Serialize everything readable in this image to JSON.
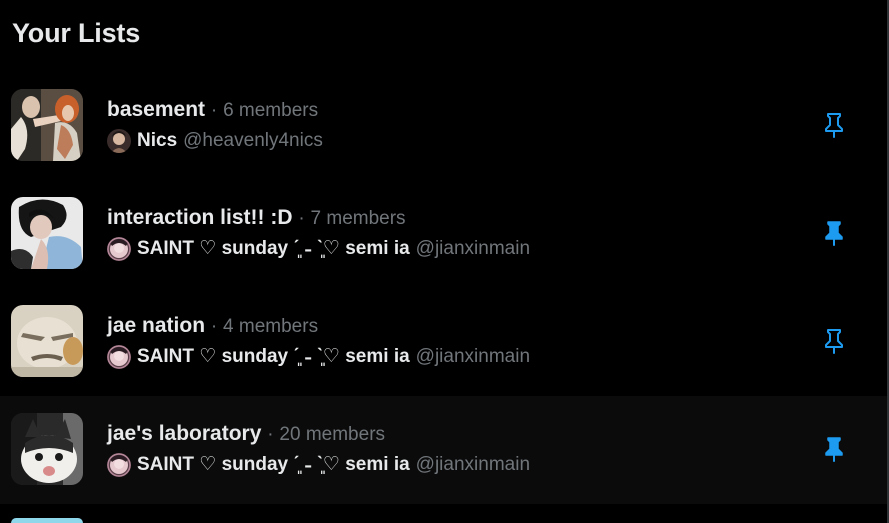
{
  "section": {
    "title": "Your Lists"
  },
  "sep": "·",
  "lists": [
    {
      "name": "basement",
      "members": "6 members",
      "owner_name": "Nics",
      "owner_handle": "@heavenly4nics",
      "pinned": false
    },
    {
      "name": "interaction list!! :D",
      "members": "7 members",
      "owner_name": "SAINT ♡ sunday ˊ͈ ˗ ˋ͈♡ semi ia",
      "owner_handle": "@jianxinmain",
      "pinned": true
    },
    {
      "name": "jae nation",
      "members": "4 members",
      "owner_name": "SAINT ♡ sunday ˊ͈ ˗ ˋ͈♡ semi ia",
      "owner_handle": "@jianxinmain",
      "pinned": false
    },
    {
      "name": "jae's laboratory",
      "members": "20 members",
      "owner_name": "SAINT ♡ sunday ˊ͈ ˗ ˋ͈♡ semi ia",
      "owner_handle": "@jianxinmain",
      "pinned": true
    }
  ],
  "colors": {
    "background": "#000000",
    "hover_row": "#0b0b0b",
    "primary_text": "#e7e9ea",
    "secondary_text": "#71767b",
    "accent_blue": "#1d9bf0"
  },
  "icons": {
    "pin_outline": "pin-outline-icon",
    "pin_filled": "pin-filled-icon"
  }
}
